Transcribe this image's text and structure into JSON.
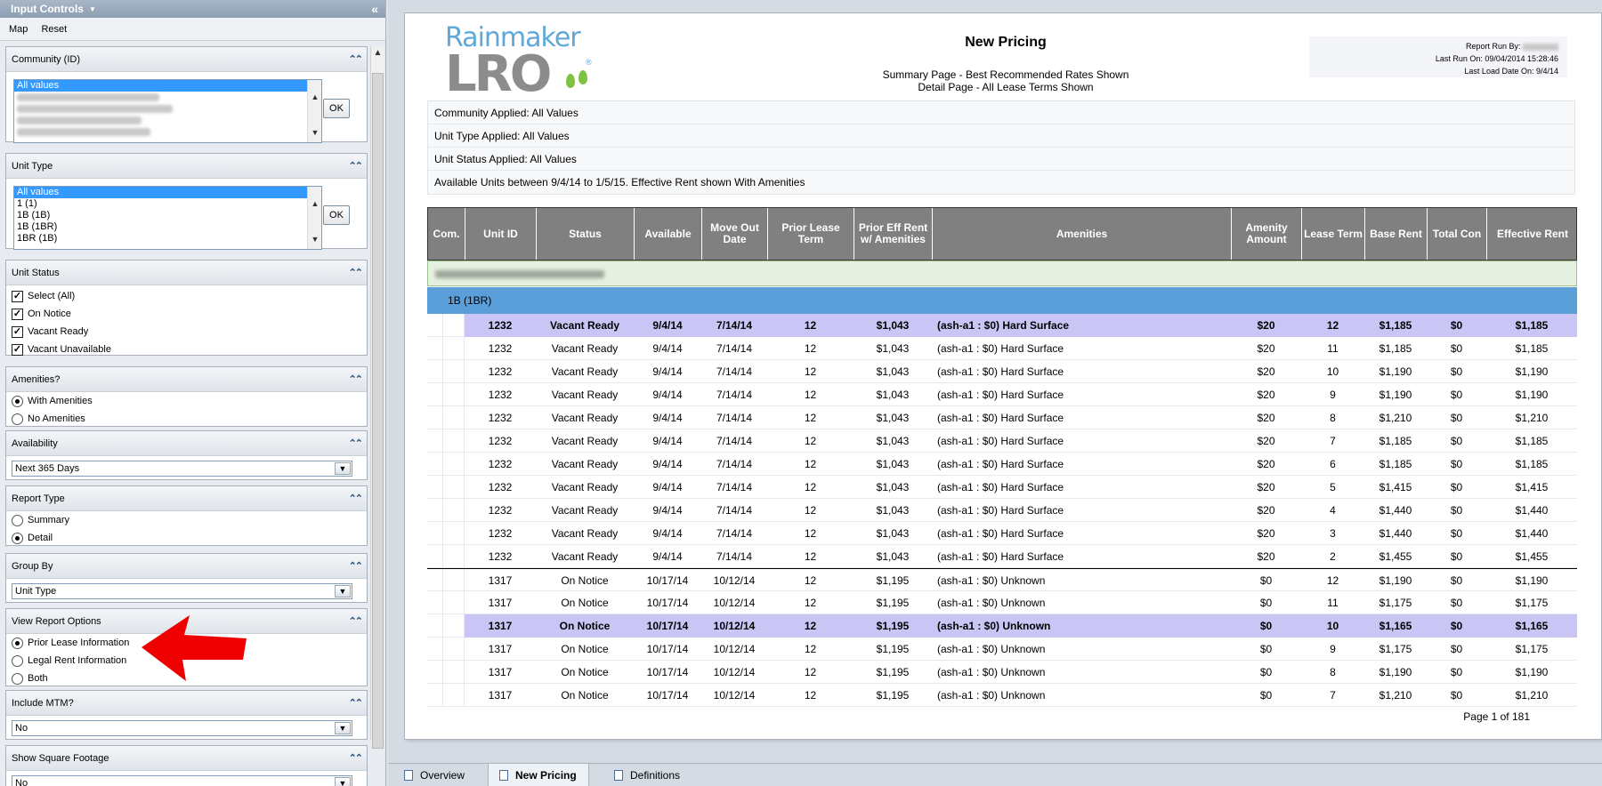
{
  "left_panel": {
    "title": "Input Controls",
    "toolbar": {
      "map": "Map",
      "reset": "Reset"
    },
    "community": {
      "label": "Community (ID)",
      "options": [
        "All values"
      ],
      "ok": "OK"
    },
    "unit_type": {
      "label": "Unit Type",
      "options": [
        "All values",
        "1 (1)",
        "1B (1B)",
        "1B (1BR)",
        "1BR (1B)"
      ],
      "ok": "OK"
    },
    "unit_status": {
      "label": "Unit Status",
      "items": [
        "Select (All)",
        "On Notice",
        "Vacant Ready",
        "Vacant Unavailable"
      ]
    },
    "amenities": {
      "label": "Amenities?",
      "items": [
        "With Amenities",
        "No Amenities"
      ]
    },
    "availability": {
      "label": "Availability",
      "value": "Next 365 Days"
    },
    "report_type": {
      "label": "Report Type",
      "items": [
        "Summary",
        "Detail"
      ]
    },
    "group_by": {
      "label": "Group By",
      "value": "Unit Type"
    },
    "view_options": {
      "label": "View Report Options",
      "items": [
        "Prior Lease Information",
        "Legal Rent Information",
        "Both"
      ]
    },
    "include_mtm": {
      "label": "Include MTM?",
      "value": "No"
    },
    "square_footage": {
      "label": "Show Square Footage",
      "value": "No"
    }
  },
  "report": {
    "title": "New Pricing",
    "subtitle1": "Summary Page - Best Recommended Rates Shown",
    "subtitle2": "Detail Page - All Lease Terms Shown",
    "run_by": "Report Run By:",
    "last_run": "Last Run On: 09/04/2014 15:28:46",
    "last_load": "Last Load Date On: 9/4/14",
    "filters": [
      "Community Applied: All Values",
      "Unit Type Applied: All Values",
      "Unit Status Applied: All Values",
      "Available Units between 9/4/14 to 1/5/15. Effective Rent shown With Amenities"
    ],
    "headers": [
      "Com.",
      "Unit ID",
      "Status",
      "Available",
      "Move Out Date",
      "Prior Lease Term",
      "Prior Eff Rent w/ Amenities",
      "Amenities",
      "Amenity Amount",
      "Lease Term",
      "Base Rent",
      "Total Con",
      "Effective Rent"
    ],
    "unit_group": "1B (1BR)",
    "rows": [
      [
        "1232",
        "Vacant Ready",
        "9/4/14",
        "7/14/14",
        "12",
        "$1,043",
        "(ash-a1 : $0)  Hard Surface",
        "$20",
        "12",
        "$1,185",
        "$0",
        "$1,185"
      ],
      [
        "1232",
        "Vacant Ready",
        "9/4/14",
        "7/14/14",
        "12",
        "$1,043",
        "(ash-a1 : $0)  Hard Surface",
        "$20",
        "11",
        "$1,185",
        "$0",
        "$1,185"
      ],
      [
        "1232",
        "Vacant Ready",
        "9/4/14",
        "7/14/14",
        "12",
        "$1,043",
        "(ash-a1 : $0)  Hard Surface",
        "$20",
        "10",
        "$1,190",
        "$0",
        "$1,190"
      ],
      [
        "1232",
        "Vacant Ready",
        "9/4/14",
        "7/14/14",
        "12",
        "$1,043",
        "(ash-a1 : $0)  Hard Surface",
        "$20",
        "9",
        "$1,190",
        "$0",
        "$1,190"
      ],
      [
        "1232",
        "Vacant Ready",
        "9/4/14",
        "7/14/14",
        "12",
        "$1,043",
        "(ash-a1 : $0)  Hard Surface",
        "$20",
        "8",
        "$1,210",
        "$0",
        "$1,210"
      ],
      [
        "1232",
        "Vacant Ready",
        "9/4/14",
        "7/14/14",
        "12",
        "$1,043",
        "(ash-a1 : $0)  Hard Surface",
        "$20",
        "7",
        "$1,185",
        "$0",
        "$1,185"
      ],
      [
        "1232",
        "Vacant Ready",
        "9/4/14",
        "7/14/14",
        "12",
        "$1,043",
        "(ash-a1 : $0)  Hard Surface",
        "$20",
        "6",
        "$1,185",
        "$0",
        "$1,185"
      ],
      [
        "1232",
        "Vacant Ready",
        "9/4/14",
        "7/14/14",
        "12",
        "$1,043",
        "(ash-a1 : $0)  Hard Surface",
        "$20",
        "5",
        "$1,415",
        "$0",
        "$1,415"
      ],
      [
        "1232",
        "Vacant Ready",
        "9/4/14",
        "7/14/14",
        "12",
        "$1,043",
        "(ash-a1 : $0)  Hard Surface",
        "$20",
        "4",
        "$1,440",
        "$0",
        "$1,440"
      ],
      [
        "1232",
        "Vacant Ready",
        "9/4/14",
        "7/14/14",
        "12",
        "$1,043",
        "(ash-a1 : $0)  Hard Surface",
        "$20",
        "3",
        "$1,440",
        "$0",
        "$1,440"
      ],
      [
        "1232",
        "Vacant Ready",
        "9/4/14",
        "7/14/14",
        "12",
        "$1,043",
        "(ash-a1 : $0)  Hard Surface",
        "$20",
        "2",
        "$1,455",
        "$0",
        "$1,455"
      ],
      [
        "1317",
        "On Notice",
        "10/17/14",
        "10/12/14",
        "12",
        "$1,195",
        "(ash-a1 : $0)  Unknown",
        "$0",
        "12",
        "$1,190",
        "$0",
        "$1,190"
      ],
      [
        "1317",
        "On Notice",
        "10/17/14",
        "10/12/14",
        "12",
        "$1,195",
        "(ash-a1 : $0)  Unknown",
        "$0",
        "11",
        "$1,175",
        "$0",
        "$1,175"
      ],
      [
        "1317",
        "On Notice",
        "10/17/14",
        "10/12/14",
        "12",
        "$1,195",
        "(ash-a1 : $0)  Unknown",
        "$0",
        "10",
        "$1,165",
        "$0",
        "$1,165"
      ],
      [
        "1317",
        "On Notice",
        "10/17/14",
        "10/12/14",
        "12",
        "$1,195",
        "(ash-a1 : $0)  Unknown",
        "$0",
        "9",
        "$1,175",
        "$0",
        "$1,175"
      ],
      [
        "1317",
        "On Notice",
        "10/17/14",
        "10/12/14",
        "12",
        "$1,195",
        "(ash-a1 : $0)  Unknown",
        "$0",
        "8",
        "$1,190",
        "$0",
        "$1,190"
      ],
      [
        "1317",
        "On Notice",
        "10/17/14",
        "10/12/14",
        "12",
        "$1,195",
        "(ash-a1 : $0)  Unknown",
        "$0",
        "7",
        "$1,210",
        "$0",
        "$1,210"
      ]
    ],
    "highlighted_rows": [
      0,
      13
    ],
    "page_label": "Page 1 of 181"
  },
  "tabs": [
    "Overview",
    "New Pricing",
    "Definitions"
  ],
  "active_tab": "New Pricing",
  "colors": {
    "header_gray": "#808080",
    "unit_band": "#5b9fda",
    "highlight": "#c9c6f5",
    "arrow": "#ee0000"
  }
}
